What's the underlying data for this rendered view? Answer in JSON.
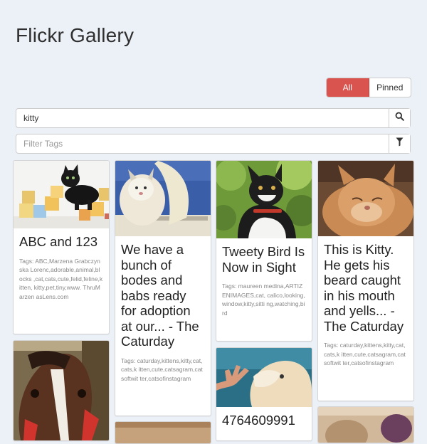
{
  "header": {
    "title": "Flickr Gallery"
  },
  "toggle": {
    "all_label": "All",
    "pinned_label": "Pinned",
    "active": "All"
  },
  "search": {
    "value": "kitty",
    "placeholder": ""
  },
  "tag_filter": {
    "value": "",
    "placeholder": "Filter Tags"
  },
  "icons": {
    "search": "search-icon",
    "filter": "filter-icon"
  },
  "colors": {
    "accent": "#d9534f",
    "background": "#ecf1f8"
  },
  "cards": [
    {
      "title": "ABC and 123",
      "tags": "Tags: ABC,Marzena Grabczynska Lorenc,adorable,animal,blocks ,cat,cats,cute,felid,feline,kitten, kitty,pet,tiny,www. ThruMarzen asLens.com"
    },
    {
      "title": "We have a bunch of bodes and babs ready for adoption at our... - The Caturday",
      "tags": "Tags: caturday,kittens,kitty,cat,cats,k itten,cute,catsagram,catsoftwit ter,catsofinstagram"
    },
    {
      "title": "Tweety Bird Is Now in Sight",
      "tags": "Tags: maureen medina,ARTIZENIMAGES,cat, calico,looking,window,kitty,sitti ng,watching,bird"
    },
    {
      "title": "This is Kitty. He gets his beard caught in his mouth and yells... - The Caturday",
      "tags": "Tags: caturday,kittens,kitty,cat,cats,k itten,cute,catsagram,catsoftwit ter,catsofinstagram"
    },
    {
      "title": "",
      "tags": ""
    },
    {
      "title": "",
      "tags": ""
    },
    {
      "title": "4764609991",
      "tags": ""
    },
    {
      "title": "",
      "tags": ""
    }
  ]
}
